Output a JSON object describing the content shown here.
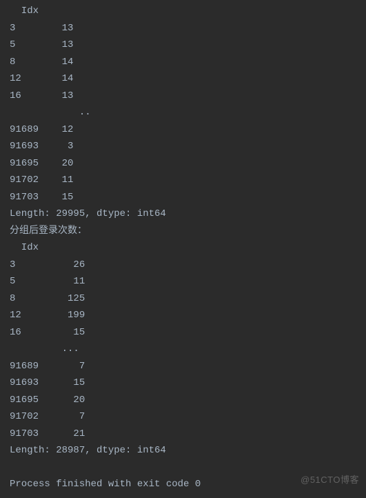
{
  "console": {
    "block1": {
      "header": "  Idx",
      "rows": [
        {
          "idx": "3",
          "val": "13"
        },
        {
          "idx": "5",
          "val": "13"
        },
        {
          "idx": "8",
          "val": "14"
        },
        {
          "idx": "12",
          "val": "14"
        },
        {
          "idx": "16",
          "val": "13"
        }
      ],
      "ellipsis": "            ..",
      "tail_rows": [
        {
          "idx": "91689",
          "val": "12"
        },
        {
          "idx": "91693",
          "val": "3"
        },
        {
          "idx": "91695",
          "val": "20"
        },
        {
          "idx": "91702",
          "val": "11"
        },
        {
          "idx": "91703",
          "val": "15"
        }
      ],
      "footer": "Length: 29995, dtype: int64"
    },
    "section_label": "分组后登录次数：",
    "block2": {
      "header": "  Idx",
      "rows": [
        {
          "idx": "3",
          "val": "26"
        },
        {
          "idx": "5",
          "val": "11"
        },
        {
          "idx": "8",
          "val": "125"
        },
        {
          "idx": "12",
          "val": "199"
        },
        {
          "idx": "16",
          "val": "15"
        }
      ],
      "ellipsis": "         ... ",
      "tail_rows": [
        {
          "idx": "91689",
          "val": "7"
        },
        {
          "idx": "91693",
          "val": "15"
        },
        {
          "idx": "91695",
          "val": "20"
        },
        {
          "idx": "91702",
          "val": "7"
        },
        {
          "idx": "91703",
          "val": "21"
        }
      ],
      "footer": "Length: 28987, dtype: int64"
    },
    "exit_line": "Process finished with exit code 0"
  },
  "watermark": "@51CTO博客"
}
